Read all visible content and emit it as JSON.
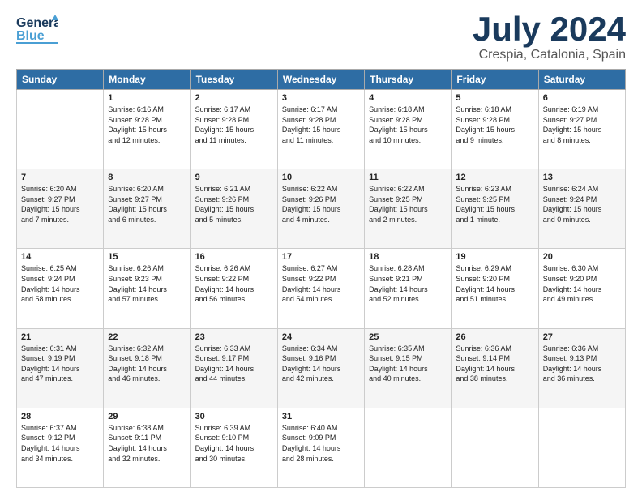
{
  "header": {
    "logo": {
      "general": "General",
      "blue": "Blue"
    },
    "title": "July 2024",
    "subtitle": "Crespia, Catalonia, Spain"
  },
  "days_of_week": [
    "Sunday",
    "Monday",
    "Tuesday",
    "Wednesday",
    "Thursday",
    "Friday",
    "Saturday"
  ],
  "weeks": [
    [
      {
        "day": "",
        "info": ""
      },
      {
        "day": "1",
        "info": "Sunrise: 6:16 AM\nSunset: 9:28 PM\nDaylight: 15 hours\nand 12 minutes."
      },
      {
        "day": "2",
        "info": "Sunrise: 6:17 AM\nSunset: 9:28 PM\nDaylight: 15 hours\nand 11 minutes."
      },
      {
        "day": "3",
        "info": "Sunrise: 6:17 AM\nSunset: 9:28 PM\nDaylight: 15 hours\nand 11 minutes."
      },
      {
        "day": "4",
        "info": "Sunrise: 6:18 AM\nSunset: 9:28 PM\nDaylight: 15 hours\nand 10 minutes."
      },
      {
        "day": "5",
        "info": "Sunrise: 6:18 AM\nSunset: 9:28 PM\nDaylight: 15 hours\nand 9 minutes."
      },
      {
        "day": "6",
        "info": "Sunrise: 6:19 AM\nSunset: 9:27 PM\nDaylight: 15 hours\nand 8 minutes."
      }
    ],
    [
      {
        "day": "7",
        "info": "Sunrise: 6:20 AM\nSunset: 9:27 PM\nDaylight: 15 hours\nand 7 minutes."
      },
      {
        "day": "8",
        "info": "Sunrise: 6:20 AM\nSunset: 9:27 PM\nDaylight: 15 hours\nand 6 minutes."
      },
      {
        "day": "9",
        "info": "Sunrise: 6:21 AM\nSunset: 9:26 PM\nDaylight: 15 hours\nand 5 minutes."
      },
      {
        "day": "10",
        "info": "Sunrise: 6:22 AM\nSunset: 9:26 PM\nDaylight: 15 hours\nand 4 minutes."
      },
      {
        "day": "11",
        "info": "Sunrise: 6:22 AM\nSunset: 9:25 PM\nDaylight: 15 hours\nand 2 minutes."
      },
      {
        "day": "12",
        "info": "Sunrise: 6:23 AM\nSunset: 9:25 PM\nDaylight: 15 hours\nand 1 minute."
      },
      {
        "day": "13",
        "info": "Sunrise: 6:24 AM\nSunset: 9:24 PM\nDaylight: 15 hours\nand 0 minutes."
      }
    ],
    [
      {
        "day": "14",
        "info": "Sunrise: 6:25 AM\nSunset: 9:24 PM\nDaylight: 14 hours\nand 58 minutes."
      },
      {
        "day": "15",
        "info": "Sunrise: 6:26 AM\nSunset: 9:23 PM\nDaylight: 14 hours\nand 57 minutes."
      },
      {
        "day": "16",
        "info": "Sunrise: 6:26 AM\nSunset: 9:22 PM\nDaylight: 14 hours\nand 56 minutes."
      },
      {
        "day": "17",
        "info": "Sunrise: 6:27 AM\nSunset: 9:22 PM\nDaylight: 14 hours\nand 54 minutes."
      },
      {
        "day": "18",
        "info": "Sunrise: 6:28 AM\nSunset: 9:21 PM\nDaylight: 14 hours\nand 52 minutes."
      },
      {
        "day": "19",
        "info": "Sunrise: 6:29 AM\nSunset: 9:20 PM\nDaylight: 14 hours\nand 51 minutes."
      },
      {
        "day": "20",
        "info": "Sunrise: 6:30 AM\nSunset: 9:20 PM\nDaylight: 14 hours\nand 49 minutes."
      }
    ],
    [
      {
        "day": "21",
        "info": "Sunrise: 6:31 AM\nSunset: 9:19 PM\nDaylight: 14 hours\nand 47 minutes."
      },
      {
        "day": "22",
        "info": "Sunrise: 6:32 AM\nSunset: 9:18 PM\nDaylight: 14 hours\nand 46 minutes."
      },
      {
        "day": "23",
        "info": "Sunrise: 6:33 AM\nSunset: 9:17 PM\nDaylight: 14 hours\nand 44 minutes."
      },
      {
        "day": "24",
        "info": "Sunrise: 6:34 AM\nSunset: 9:16 PM\nDaylight: 14 hours\nand 42 minutes."
      },
      {
        "day": "25",
        "info": "Sunrise: 6:35 AM\nSunset: 9:15 PM\nDaylight: 14 hours\nand 40 minutes."
      },
      {
        "day": "26",
        "info": "Sunrise: 6:36 AM\nSunset: 9:14 PM\nDaylight: 14 hours\nand 38 minutes."
      },
      {
        "day": "27",
        "info": "Sunrise: 6:36 AM\nSunset: 9:13 PM\nDaylight: 14 hours\nand 36 minutes."
      }
    ],
    [
      {
        "day": "28",
        "info": "Sunrise: 6:37 AM\nSunset: 9:12 PM\nDaylight: 14 hours\nand 34 minutes."
      },
      {
        "day": "29",
        "info": "Sunrise: 6:38 AM\nSunset: 9:11 PM\nDaylight: 14 hours\nand 32 minutes."
      },
      {
        "day": "30",
        "info": "Sunrise: 6:39 AM\nSunset: 9:10 PM\nDaylight: 14 hours\nand 30 minutes."
      },
      {
        "day": "31",
        "info": "Sunrise: 6:40 AM\nSunset: 9:09 PM\nDaylight: 14 hours\nand 28 minutes."
      },
      {
        "day": "",
        "info": ""
      },
      {
        "day": "",
        "info": ""
      },
      {
        "day": "",
        "info": ""
      }
    ]
  ]
}
